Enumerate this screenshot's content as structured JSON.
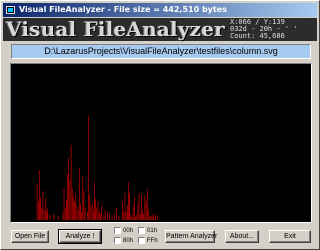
{
  "window": {
    "title": "Visual FileAnalyzer - File size = 442,510 bytes"
  },
  "logo": {
    "text": "Visual FileAnalyzer"
  },
  "coords": {
    "line1": "X:066 / Y:139",
    "line2": "032d - 20h - ' '",
    "line3": "Count: 45,686"
  },
  "path": "D:\\LazarusProjects\\VisualFileAnalyzer\\testfiles\\column.svg",
  "histogram": {
    "bar_color": "#e00000",
    "bars": [
      [
        22,
        0.34
      ],
      [
        23,
        0.18
      ],
      [
        24,
        0.48
      ],
      [
        25,
        0.22
      ],
      [
        26,
        0.12
      ],
      [
        27,
        0.28
      ],
      [
        28,
        0.1
      ],
      [
        29,
        0.2
      ],
      [
        30,
        0.08
      ],
      [
        31,
        0.12
      ],
      [
        33,
        0.05
      ],
      [
        36,
        0.06
      ],
      [
        40,
        0.04
      ],
      [
        44,
        0.07
      ],
      [
        45,
        0.3
      ],
      [
        46,
        0.12
      ],
      [
        47,
        0.2
      ],
      [
        48,
        0.44
      ],
      [
        49,
        0.6
      ],
      [
        50,
        0.38
      ],
      [
        51,
        0.72
      ],
      [
        52,
        0.3
      ],
      [
        53,
        0.22
      ],
      [
        54,
        0.18
      ],
      [
        55,
        0.26
      ],
      [
        56,
        0.14
      ],
      [
        57,
        0.1
      ],
      [
        58,
        0.5
      ],
      [
        59,
        0.16
      ],
      [
        60,
        0.08
      ],
      [
        61,
        0.42
      ],
      [
        62,
        0.28
      ],
      [
        63,
        0.12
      ],
      [
        65,
        0.08
      ],
      [
        66,
        1.0
      ],
      [
        67,
        0.24
      ],
      [
        68,
        0.14
      ],
      [
        69,
        0.16
      ],
      [
        70,
        0.1
      ],
      [
        71,
        0.36
      ],
      [
        72,
        0.2
      ],
      [
        73,
        0.12
      ],
      [
        74,
        0.18
      ],
      [
        75,
        0.08
      ],
      [
        76,
        0.06
      ],
      [
        77,
        0.14
      ],
      [
        79,
        0.05
      ],
      [
        80,
        0.1
      ],
      [
        82,
        0.08
      ],
      [
        84,
        0.05
      ],
      [
        86,
        0.04
      ],
      [
        88,
        0.06
      ],
      [
        90,
        0.12
      ],
      [
        92,
        0.04
      ],
      [
        95,
        0.18
      ],
      [
        96,
        0.08
      ],
      [
        97,
        0.26
      ],
      [
        98,
        0.08
      ],
      [
        99,
        0.14
      ],
      [
        100,
        0.36
      ],
      [
        101,
        0.26
      ],
      [
        102,
        0.06
      ],
      [
        103,
        0.04
      ],
      [
        104,
        0.14
      ],
      [
        105,
        0.22
      ],
      [
        106,
        0.03
      ],
      [
        107,
        0.05
      ],
      [
        108,
        0.16
      ],
      [
        109,
        0.26
      ],
      [
        110,
        0.06
      ],
      [
        111,
        0.24
      ],
      [
        112,
        0.1
      ],
      [
        113,
        0.06
      ],
      [
        114,
        0.24
      ],
      [
        115,
        0.18
      ],
      [
        116,
        0.3
      ],
      [
        117,
        0.1
      ],
      [
        118,
        0.02
      ],
      [
        119,
        0.04
      ],
      [
        120,
        0.04
      ],
      [
        121,
        0.06
      ],
      [
        122,
        0.02
      ],
      [
        123,
        0.06
      ],
      [
        125,
        0.04
      ]
    ]
  },
  "buttons": {
    "open_file": "Open File",
    "analyze": "Analyze !",
    "pattern_analyzer": "Pattern Analyzer",
    "about": "About...",
    "exit": "Exit"
  },
  "checkboxes": {
    "c00h": "00h",
    "c01h": "01h",
    "c80h": "80h",
    "cffh": "FFh"
  }
}
